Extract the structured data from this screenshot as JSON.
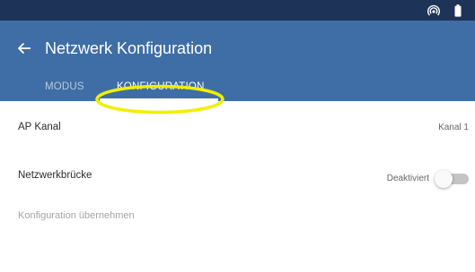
{
  "header": {
    "title": "Netzwerk Konfiguration",
    "back_icon": "arrow-left-icon"
  },
  "status_bar": {
    "icons": [
      "hotspot-icon",
      "battery-icon"
    ]
  },
  "tabs": [
    {
      "label": "MODUS",
      "selected": false
    },
    {
      "label": "KONFIGURATION",
      "selected": true
    }
  ],
  "settings": {
    "ap_channel": {
      "label": "AP Kanal",
      "value": "Kanal 1"
    },
    "bridge": {
      "label": "Netzwerkbrücke",
      "status": "Deaktiviert",
      "enabled": false
    },
    "apply_label": "Konfiguration übernehmen"
  },
  "colors": {
    "status_bar": "#1d3358",
    "app_bar": "#3f6ea6",
    "highlight": "#f2ef00"
  }
}
